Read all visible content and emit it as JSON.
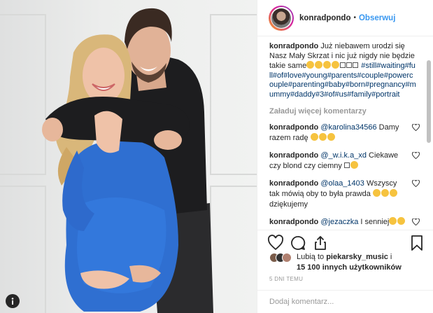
{
  "post": {
    "username": "konradpondo",
    "follow_separator": "•",
    "follow_label": "Obserwuj"
  },
  "caption": {
    "username": "konradpondo",
    "text": "Już niebawem urodzi się Nasz Mały Skrzat i nic już nigdy nie będzie takie same",
    "hashtags": "#still#waiting#full#of#love#young#parents#couple#powercouple#parenting#baby#born#pregnancy#mummy#daddy#3#of#us#family#portrait"
  },
  "load_more_label": "Załaduj więcej komentarzy",
  "comments": [
    {
      "username": "konradpondo",
      "mention": "@karolina34566",
      "text": " Damy razem radę "
    },
    {
      "username": "konradpondo",
      "mention": "@_w.i.k.a_xd",
      "text": " Ciekawe czy blond czy ciemny "
    },
    {
      "username": "konradpondo",
      "mention": "@olaa_1403",
      "text": " Wszyscy tak mówią oby to była prawda ",
      "text2": " dziękujemy"
    },
    {
      "username": "konradpondo",
      "mention": "@jezaczka",
      "text": " I senniej"
    }
  ],
  "likes": {
    "prefix": "Lubią to ",
    "user": "piekarsky_music",
    "connector": " i",
    "others": "15 100 innych użytkowników"
  },
  "timestamp": "5 DNI TEMU",
  "comment_input": {
    "placeholder": "Dodaj komentarz..."
  },
  "icons": [
    "like-heart-icon",
    "comment-icon",
    "share-icon",
    "bookmark-icon",
    "info-icon"
  ],
  "colors": {
    "accent": "#3897f0",
    "hashtag": "#003569",
    "dress": "#2f6fd1",
    "muted": "#999999"
  }
}
